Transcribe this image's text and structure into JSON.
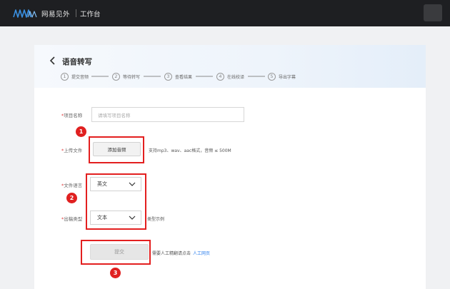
{
  "topbar": {
    "brand": "网易见外",
    "workspace": "工作台"
  },
  "page": {
    "title": "语音转写"
  },
  "steps": [
    {
      "num": "1",
      "label": "提交音频"
    },
    {
      "num": "2",
      "label": "等待转写"
    },
    {
      "num": "3",
      "label": "查看结果"
    },
    {
      "num": "4",
      "label": "在线校译"
    },
    {
      "num": "5",
      "label": "导出字幕"
    }
  ],
  "form": {
    "project_name_label": "项目名称",
    "project_name_placeholder": "请填写项目名称",
    "upload_label": "上传文件",
    "add_audio_button": "添加音频",
    "upload_hint": "支持mp3、wav、aac格式，音频 ≤ 500M",
    "language_label": "文件语言",
    "language_value": "英文",
    "output_type_label": "出稿类型",
    "output_type_value": "文本",
    "output_type_example": "类型示例",
    "submit_button": "提交",
    "submit_note": "需要人工精翻请点击",
    "submit_note_link": "人工网页",
    "required_mark": "*"
  },
  "annotations": [
    "1",
    "2",
    "3"
  ],
  "colors": {
    "topbar": "#1e1f22",
    "accent_link": "#2f80ed",
    "annotation_red": "#e31f1f",
    "logo_blue": "#3a8fe0"
  },
  "icons": {
    "logo": "waves-logo-icon",
    "back": "chevron-left-icon",
    "dropdown": "chevron-down-icon"
  }
}
